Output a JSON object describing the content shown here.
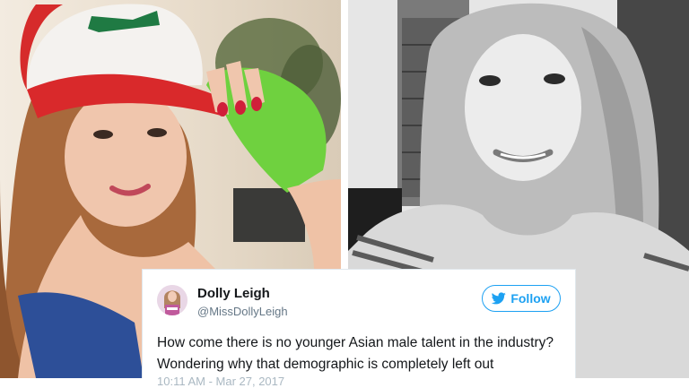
{
  "tweet": {
    "display_name": "Dolly Leigh",
    "handle": "@MissDollyLeigh",
    "follow_label": "Follow",
    "text_line1": "How come there is no younger Asian male talent in the industry?",
    "text_line2": "Wondering why that demographic is completely left out",
    "timestamp": "10:11 AM - Mar 27, 2017"
  },
  "icons": {
    "follow_icon": "twitter-bird-icon"
  },
  "colors": {
    "accent": "#1da1f2",
    "name_text": "#14171a",
    "secondary_text": "#657786"
  }
}
